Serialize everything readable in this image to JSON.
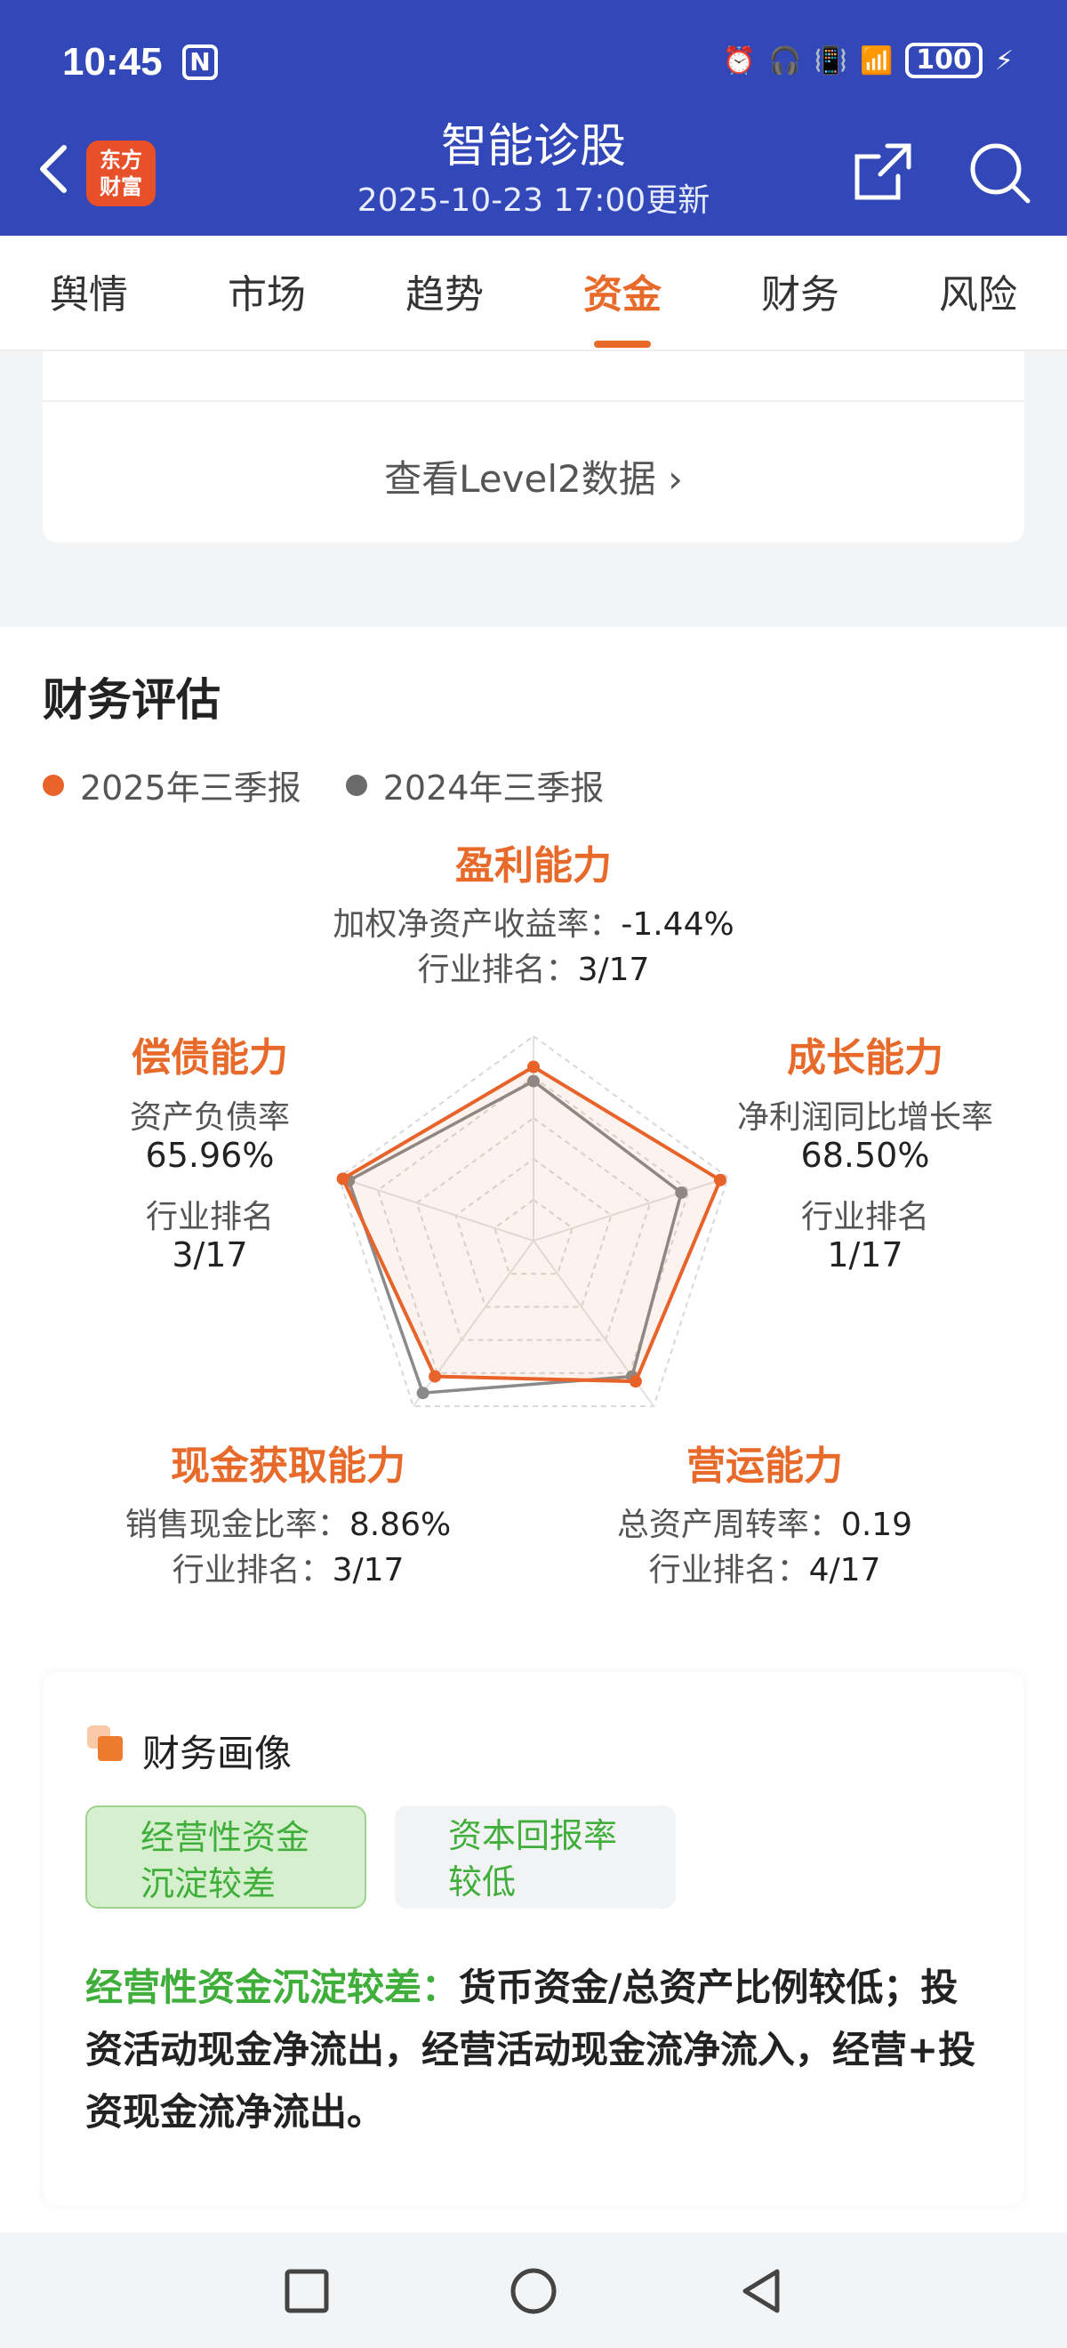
{
  "status": {
    "time": "10:45",
    "n_badge": "N",
    "battery": "100"
  },
  "header": {
    "logo": [
      "东方",
      "财富"
    ],
    "title": "智能诊股",
    "updated": "2025-10-23 17:00更新"
  },
  "tabs": [
    "舆情",
    "市场",
    "趋势",
    "资金",
    "财务",
    "风险"
  ],
  "active_tab": "资金",
  "level2_link": "查看Level2数据 ›",
  "assessment": {
    "title": "财务评估",
    "legend": [
      {
        "label": "2025年三季报",
        "color": "#e8632a"
      },
      {
        "label": "2024年三季报",
        "color": "#6b6b6b"
      }
    ],
    "profit": {
      "title": "盈利能力",
      "metric": "加权净资产收益率：",
      "value": "-1.44%",
      "rank_label": "行业排名：",
      "rank": "3/17"
    },
    "growth": {
      "title": "成长能力",
      "metric": "净利润同比增长率",
      "value": "68.50%",
      "rank_label": "行业排名",
      "rank": "1/17"
    },
    "operation": {
      "title": "营运能力",
      "metric": "总资产周转率：",
      "value": "0.19",
      "rank_label": "行业排名：",
      "rank": "4/17"
    },
    "cash": {
      "title": "现金获取能力",
      "metric": "销售现金比率：",
      "value": "8.86%",
      "rank_label": "行业排名：",
      "rank": "3/17"
    },
    "solvency": {
      "title": "偿债能力",
      "metric": "资产负债率",
      "value": "65.96%",
      "rank_label": "行业排名",
      "rank": "3/17"
    }
  },
  "chart_data": {
    "type": "radar",
    "axes": [
      "盈利能力",
      "成长能力",
      "营运能力",
      "现金获取能力",
      "偿债能力"
    ],
    "range": [
      0,
      1
    ],
    "series": [
      {
        "name": "2025年三季报",
        "color": "#e8632a",
        "values": [
          0.85,
          0.96,
          0.85,
          0.82,
          0.98
        ]
      },
      {
        "name": "2024年三季报",
        "color": "#8a8a8a",
        "values": [
          0.78,
          0.76,
          0.82,
          0.92,
          0.95
        ]
      }
    ]
  },
  "portrait": {
    "title": "财务画像",
    "tags": [
      {
        "line1": "经营性资金",
        "line2": "沉淀较差"
      },
      {
        "line1": "资本回报率",
        "line2": "较低"
      }
    ],
    "desc_highlight": "经营性资金沉淀较差：",
    "desc_text": "货币资金/总资产比例较低；投资活动现金净流出，经营活动现金流净流入，经营+投资现金流净流出。"
  }
}
